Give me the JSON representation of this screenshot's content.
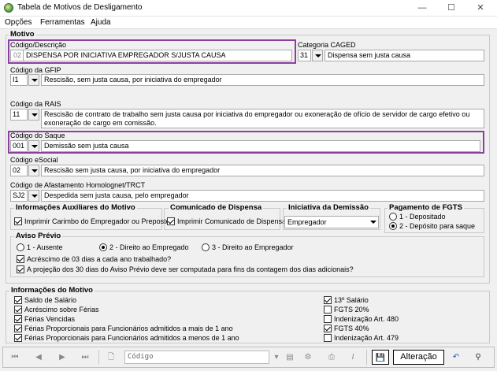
{
  "window": {
    "title": "Tabela de Motivos de Desligamento",
    "minimize": "—",
    "maximize": "☐",
    "close": "✕"
  },
  "menu": [
    "Opções",
    "Ferramentas",
    "Ajuda"
  ],
  "motivo": {
    "title": "Motivo",
    "codigo_label": "Código/Descrição",
    "codigo": "02",
    "descricao": "DISPENSA POR INICIATIVA EMPREGADOR S/JUSTA CAUSA",
    "caged_label": "Categoria CAGED",
    "caged_code": "31",
    "caged_text": "Dispensa sem justa causa",
    "gfip_label": "Código da GFIP",
    "gfip_code": "I1",
    "gfip_text": "Rescisão, sem justa causa, por iniciativa do empregador",
    "rais_label": "Código da RAIS",
    "rais_code": "11",
    "rais_text": "Rescisão de contrato de trabalho sem justa causa por iniciativa do empregador ou exoneração de ofício de servidor de cargo efetivo ou exoneração de cargo em comissão.",
    "saque_label": "Código do Saque",
    "saque_code": "001",
    "saque_text": "Demissão sem justa causa",
    "esocial_label": "Código eSocial",
    "esocial_code": "02",
    "esocial_text": "Rescisão sem justa causa, por iniciativa do empregador",
    "afast_label": "Código de Afastamento Homolognet/TRCT",
    "afast_code": "SJ2",
    "afast_text": "Despedida sem justa causa, pelo empregador"
  },
  "aux": {
    "title": "Informações Auxiliares do Motivo",
    "item": "Imprimir Carimbo do Empregador ou Preposto"
  },
  "comunicado": {
    "title": "Comunicado de Dispensa",
    "item": "Imprimir Comunicado de Dispensa"
  },
  "iniciativa": {
    "title": "Iniciativa da Demissão",
    "value": "Empregador"
  },
  "fgts": {
    "title": "Pagamento de FGTS",
    "opt1": "1 - Depositado",
    "opt2": "2 - Depósito para saque"
  },
  "aviso": {
    "title": "Aviso Prévio",
    "opt1": "1 - Ausente",
    "opt2": "2 - Direito ao Empregado",
    "opt3": "3 - Direito ao Empregador",
    "check1": "Acréscimo de 03 dias a cada ano trabalhado?",
    "check2": "A projeção dos 30 dias do Aviso Prévio deve ser computada para fins da contagem dos dias adicionais?"
  },
  "info": {
    "title": "Informações do Motivo",
    "left": [
      {
        "label": "Saldo de Salário",
        "checked": true
      },
      {
        "label": "Acréscimo sobre Férias",
        "checked": true
      },
      {
        "label": "Férias Vencidas",
        "checked": true
      },
      {
        "label": "Férias Proporcionais para Funcionários admitidos a mais de 1 ano",
        "checked": true
      },
      {
        "label": "Férias Proporcionais para Funcionários admitidos a menos de 1 ano",
        "checked": true
      }
    ],
    "right": [
      {
        "label": "13º Salário",
        "checked": true
      },
      {
        "label": "FGTS 20%",
        "checked": false
      },
      {
        "label": "Indenização Art. 480",
        "checked": false
      },
      {
        "label": "FGTS 40%",
        "checked": true
      },
      {
        "label": "Indenização Art. 479",
        "checked": false
      }
    ]
  },
  "toolbar": {
    "search_placeholder": "Código",
    "status": "Alteração"
  }
}
